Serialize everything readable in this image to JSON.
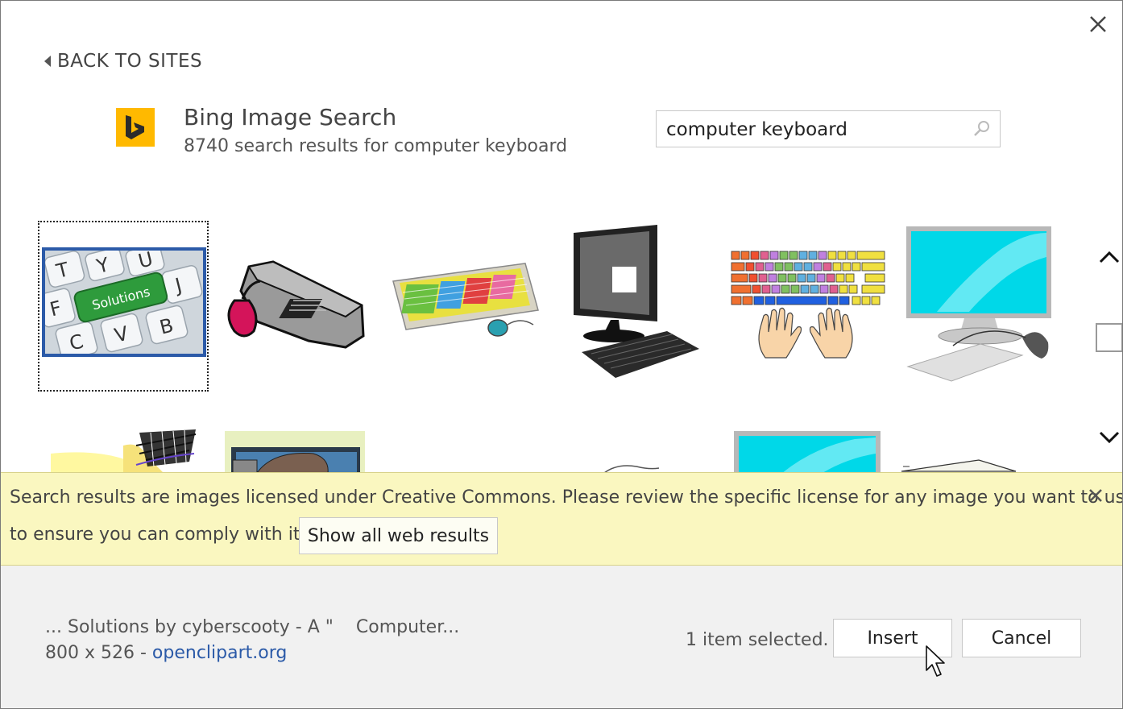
{
  "dialog": {
    "back_label": "BACK TO SITES",
    "provider_title": "Bing Image Search",
    "results_summary": "8740 search results for computer keyboard"
  },
  "search": {
    "value": "computer keyboard"
  },
  "results_thumbnail_label": "Solutions",
  "colors": {
    "accent": "#2b5aa8",
    "bing_yellow": "#ffb900",
    "banner_bg": "#faf7c0",
    "footer_bg": "#f1f1f1"
  },
  "banner": {
    "message_line1": "Search results are images licensed under Creative Commons. Please review the specific license for any image you want to use",
    "message_line2": "to ensure you can comply with it.",
    "show_all_label": "Show all web results"
  },
  "footer": {
    "selected_title": "... Solutions by cyberscooty - A \"    Computer...",
    "selected_size": "800 x 526 - ",
    "selected_source": "openclipart.org",
    "selection_count": "1 item selected.",
    "insert_label": "Insert",
    "cancel_label": "Cancel"
  },
  "icons": [
    "close-icon",
    "back-arrow-icon",
    "bing-logo-icon",
    "search-icon",
    "chevron-up-icon",
    "chevron-down-icon",
    "banner-close-icon",
    "mouse-cursor-icon"
  ]
}
